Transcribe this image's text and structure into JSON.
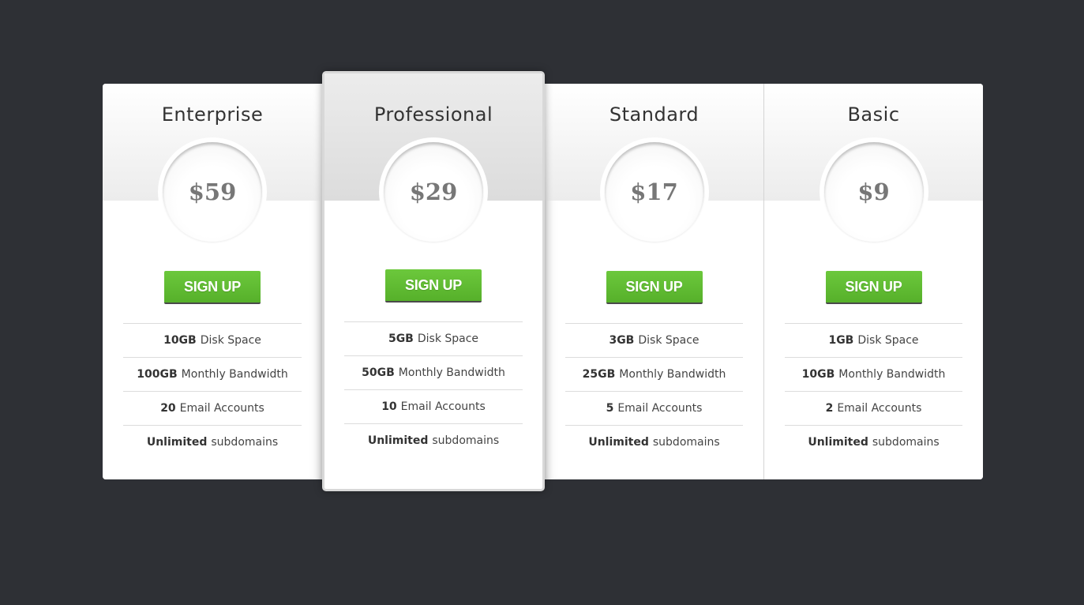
{
  "colors": {
    "background": "#2e3035",
    "button_green": "#5fbd31",
    "price_text": "#777777"
  },
  "plans": [
    {
      "name": "Enterprise",
      "price": "$59",
      "button": "SIGN UP",
      "featured": false,
      "features": [
        {
          "value": "10GB",
          "label": "Disk Space"
        },
        {
          "value": "100GB",
          "label": "Monthly Bandwidth"
        },
        {
          "value": "20",
          "label": "Email Accounts"
        },
        {
          "value": "Unlimited",
          "label": "subdomains"
        }
      ]
    },
    {
      "name": "Professional",
      "price": "$29",
      "button": "SIGN UP",
      "featured": true,
      "features": [
        {
          "value": "5GB",
          "label": "Disk Space"
        },
        {
          "value": "50GB",
          "label": "Monthly Bandwidth"
        },
        {
          "value": "10",
          "label": "Email Accounts"
        },
        {
          "value": "Unlimited",
          "label": "subdomains"
        }
      ]
    },
    {
      "name": "Standard",
      "price": "$17",
      "button": "SIGN UP",
      "featured": false,
      "features": [
        {
          "value": "3GB",
          "label": "Disk Space"
        },
        {
          "value": "25GB",
          "label": "Monthly Bandwidth"
        },
        {
          "value": "5",
          "label": "Email Accounts"
        },
        {
          "value": "Unlimited",
          "label": "subdomains"
        }
      ]
    },
    {
      "name": "Basic",
      "price": "$9",
      "button": "SIGN UP",
      "featured": false,
      "features": [
        {
          "value": "1GB",
          "label": "Disk Space"
        },
        {
          "value": "10GB",
          "label": "Monthly Bandwidth"
        },
        {
          "value": "2",
          "label": "Email Accounts"
        },
        {
          "value": "Unlimited",
          "label": "subdomains"
        }
      ]
    }
  ]
}
